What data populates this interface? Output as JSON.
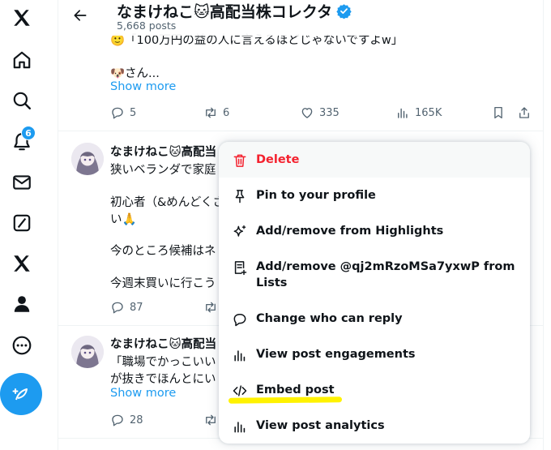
{
  "nav": {
    "notifications_badge": "6",
    "icons": [
      "x-logo-icon",
      "home-icon",
      "search-icon",
      "bell-icon",
      "mail-icon",
      "grok-icon",
      "x-premium-icon",
      "profile-icon",
      "more-icon"
    ]
  },
  "header": {
    "title": "なまけねこ🐱高配当株コレクタ",
    "posts_count": "5,668 posts"
  },
  "thread_top": {
    "cut_line": "🙂「100万円の益の人に言えるほどじゃないですよw」",
    "line": "🐶さん...",
    "show_more": "Show more",
    "actions": {
      "replies": "5",
      "reposts": "6",
      "likes": "335",
      "views": "165K"
    }
  },
  "post2": {
    "name": "なまけねこ🐱高配当",
    "lines": [
      "狭いベランダで家庭",
      "初心者（&めんどくさ",
      "い🙏",
      "今のところ候補はネ",
      "今週末買いに行こう"
    ],
    "actions": {
      "replies": "87"
    }
  },
  "post3": {
    "name": "なまけねこ🐱高配当",
    "lines": [
      "「職場でかっこいい",
      "が抜きでほんとにい"
    ],
    "show_more": "Show more",
    "actions": {
      "replies": "28"
    }
  },
  "menu": {
    "items": [
      {
        "label": "Delete",
        "icon": "trash-icon"
      },
      {
        "label": "Pin to your profile",
        "icon": "pin-icon"
      },
      {
        "label": "Add/remove from Highlights",
        "icon": "sparkle-icon"
      },
      {
        "label": "Add/remove @qj2mRzoMSa7yxwP from Lists",
        "icon": "list-icon"
      },
      {
        "label": "Change who can reply",
        "icon": "reply-bubble-icon"
      },
      {
        "label": "View post engagements",
        "icon": "chart-bars-icon"
      },
      {
        "label": "Embed post",
        "icon": "code-icon"
      },
      {
        "label": "View post analytics",
        "icon": "analytics-icon"
      }
    ]
  },
  "colors": {
    "accent": "#1d9bf0",
    "danger": "#f4212e",
    "muted": "#536471",
    "highlight": "#fff200"
  }
}
